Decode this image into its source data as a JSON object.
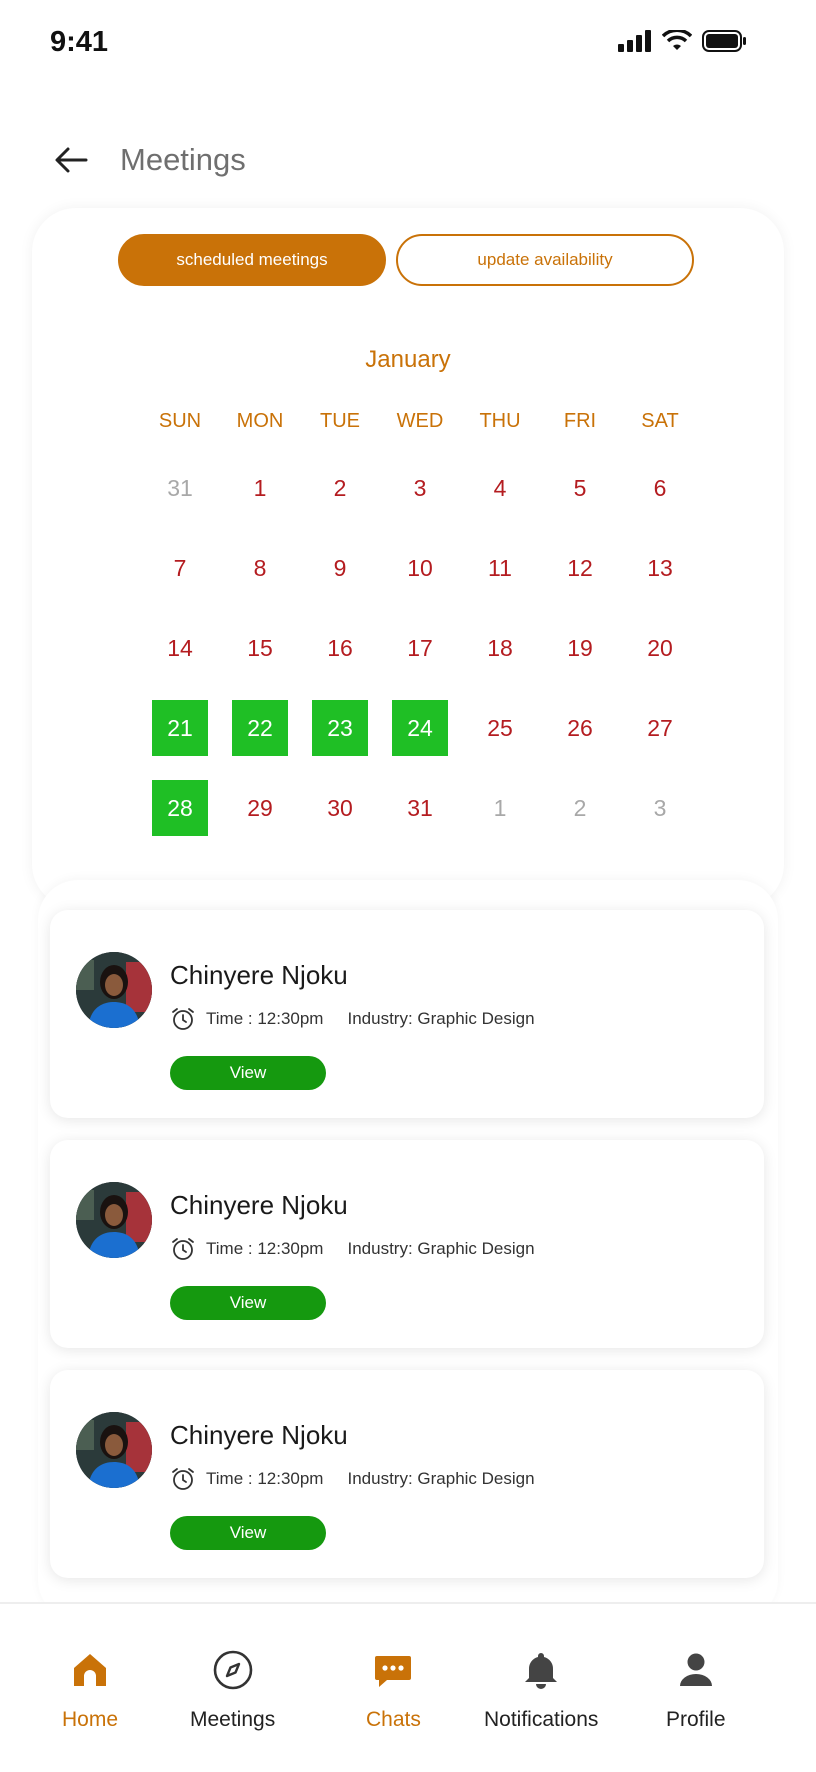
{
  "status_bar": {
    "time": "9:41"
  },
  "header": {
    "title": "Meetings"
  },
  "tabs": {
    "scheduled": "scheduled meetings",
    "availability": "update availability"
  },
  "calendar": {
    "month": "January",
    "weekdays": [
      "SUN",
      "MON",
      "TUE",
      "WED",
      "THU",
      "FRI",
      "SAT"
    ],
    "days": [
      {
        "label": "31",
        "state": "muted"
      },
      {
        "label": "1",
        "state": "normal"
      },
      {
        "label": "2",
        "state": "normal"
      },
      {
        "label": "3",
        "state": "normal"
      },
      {
        "label": "4",
        "state": "normal"
      },
      {
        "label": "5",
        "state": "normal"
      },
      {
        "label": "6",
        "state": "normal"
      },
      {
        "label": "7",
        "state": "normal"
      },
      {
        "label": "8",
        "state": "normal"
      },
      {
        "label": "9",
        "state": "normal"
      },
      {
        "label": "10",
        "state": "normal"
      },
      {
        "label": "11",
        "state": "normal"
      },
      {
        "label": "12",
        "state": "normal"
      },
      {
        "label": "13",
        "state": "normal"
      },
      {
        "label": "14",
        "state": "normal"
      },
      {
        "label": "15",
        "state": "normal"
      },
      {
        "label": "16",
        "state": "normal"
      },
      {
        "label": "17",
        "state": "normal"
      },
      {
        "label": "18",
        "state": "normal"
      },
      {
        "label": "19",
        "state": "normal"
      },
      {
        "label": "20",
        "state": "normal"
      },
      {
        "label": "21",
        "state": "selected"
      },
      {
        "label": "22",
        "state": "selected"
      },
      {
        "label": "23",
        "state": "selected"
      },
      {
        "label": "24",
        "state": "selected"
      },
      {
        "label": "25",
        "state": "normal"
      },
      {
        "label": "26",
        "state": "normal"
      },
      {
        "label": "27",
        "state": "normal"
      },
      {
        "label": "28",
        "state": "selected"
      },
      {
        "label": "29",
        "state": "normal"
      },
      {
        "label": "30",
        "state": "normal"
      },
      {
        "label": "31",
        "state": "normal"
      },
      {
        "label": "1",
        "state": "muted"
      },
      {
        "label": "2",
        "state": "muted"
      },
      {
        "label": "3",
        "state": "muted"
      }
    ]
  },
  "meetings": [
    {
      "name": "Chinyere Njoku",
      "time": "Time : 12:30pm",
      "industry": "Industry: Graphic Design",
      "view_label": "View"
    },
    {
      "name": "Chinyere Njoku",
      "time": "Time : 12:30pm",
      "industry": "Industry: Graphic Design",
      "view_label": "View"
    },
    {
      "name": "Chinyere Njoku",
      "time": "Time : 12:30pm",
      "industry": "Industry: Graphic Design",
      "view_label": "View"
    }
  ],
  "bottom_nav": [
    {
      "label": "Home",
      "icon": "home-icon",
      "color": "#c97208"
    },
    {
      "label": "Meetings",
      "icon": "compass-icon",
      "color": "#222222"
    },
    {
      "label": "Chats",
      "icon": "chat-icon",
      "color": "#c97208"
    },
    {
      "label": "Notifications",
      "icon": "bell-icon",
      "color": "#222222"
    },
    {
      "label": "Profile",
      "icon": "profile-icon",
      "color": "#222222"
    }
  ],
  "colors": {
    "accent": "#c97208",
    "selected_day": "#1fbf25",
    "view_button": "#15990f",
    "day_text": "#b41c20"
  }
}
